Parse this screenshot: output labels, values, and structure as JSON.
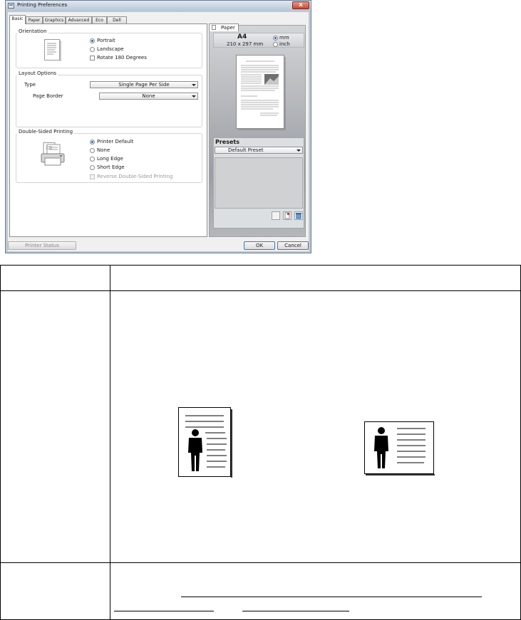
{
  "window": {
    "title": "Printing Preferences",
    "close_glyph": "x"
  },
  "tabs": [
    "Basic",
    "Paper",
    "Graphics",
    "Advanced",
    "Eco",
    "Dell"
  ],
  "orientation": {
    "title": "Orientation",
    "portrait": "Portrait",
    "landscape": "Landscape",
    "rotate": "Rotate 180 Degrees",
    "selected": "Portrait"
  },
  "layout": {
    "title": "Layout Options",
    "type_label": "Type",
    "type_value": "Single Page Per Side",
    "border_label": "Page Border",
    "border_value": "None"
  },
  "duplex": {
    "title": "Double-Sided Printing",
    "options": [
      "Printer Default",
      "None",
      "Long Edge",
      "Short Edge"
    ],
    "selected": "Printer Default",
    "reverse": "Reverse Double-Sided Printing"
  },
  "preview": {
    "tab_label": "Paper",
    "paper_name": "A4",
    "paper_size": "210 x 297 mm",
    "unit_mm": "mm",
    "unit_inch": "inch",
    "selected_unit": "mm"
  },
  "presets": {
    "title": "Presets",
    "value": "Default Preset"
  },
  "buttons": {
    "printer_status": "Printer Status",
    "ok": "OK",
    "cancel": "Cancel"
  },
  "icons": {
    "orientation": "portrait-page-icon",
    "duplex": "printer-icon",
    "doc_portrait": "portrait-figure-icon",
    "doc_landscape": "landscape-figure-icon"
  },
  "colors": {
    "dialog_frame": "#bcc9d6",
    "accent_radio": "#2a61b8",
    "preview_gray": "#9a9da2"
  }
}
